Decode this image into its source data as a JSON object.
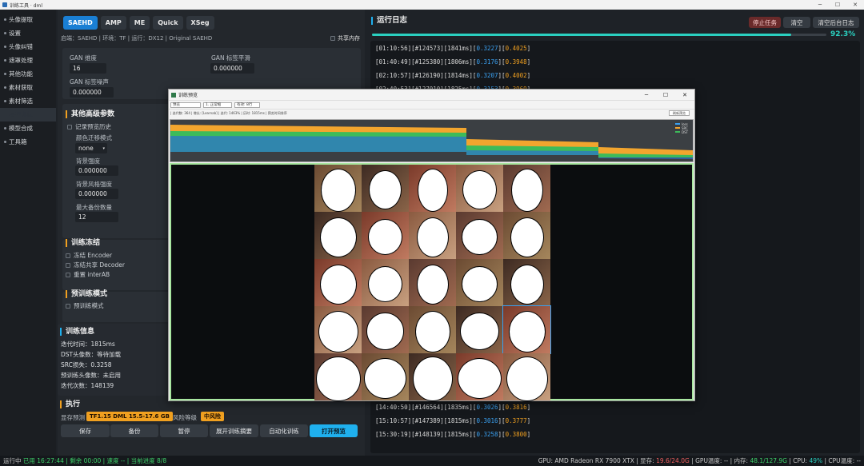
{
  "window": {
    "title": "训练工具 · dml"
  },
  "sidebar": {
    "items": [
      {
        "label": "头像提取",
        "dot": true,
        "active": false
      },
      {
        "label": "设置",
        "dot": true,
        "active": false
      },
      {
        "label": "头像纠错",
        "dot": true,
        "active": false
      },
      {
        "label": "遮罩处理",
        "dot": true,
        "active": false
      },
      {
        "label": "其他功能",
        "dot": true,
        "active": false
      },
      {
        "label": "素材获取",
        "dot": true,
        "active": false
      },
      {
        "label": "素材筛选",
        "dot": true,
        "active": false
      },
      {
        "label": "模型训练",
        "dot": false,
        "active": true
      },
      {
        "label": "模型合成",
        "dot": true,
        "active": false
      },
      {
        "label": "工具箱",
        "dot": true,
        "active": false
      }
    ]
  },
  "tabs": [
    {
      "label": "SAEHD",
      "active": true
    },
    {
      "label": "AMP"
    },
    {
      "label": "ME"
    },
    {
      "label": "Quick"
    },
    {
      "label": "XSeg"
    }
  ],
  "env": {
    "text": "启端：SAEHD | 环境：TF | 运行：DX12 | Original SAEHD",
    "share_label": "共享内存"
  },
  "gan": {
    "dims_label": "GAN 维度",
    "dims_value": "16",
    "smooth_label": "GAN 标签平滑",
    "smooth_value": "0.000000",
    "noise_label": "GAN 标签噪声",
    "noise_value": "0.000000"
  },
  "advanced": {
    "title": "其他高级参数",
    "record_history": "记录预览历史",
    "color_label": "颜色迁移模式",
    "color_value": "none",
    "bg_label": "背景强度",
    "bg_value": "0.000000",
    "bgstyle_label": "背景风格强度",
    "bgstyle_value": "0.000000",
    "backup_label": "最大备份数量",
    "backup_value": "12"
  },
  "freeze": {
    "title": "训练冻结",
    "items": [
      "冻结 Encoder",
      "冻结共享 Decoder",
      "重置 interAB"
    ]
  },
  "pretrain": {
    "title": "预训练模式",
    "item": "预训练模式"
  },
  "traininfo": {
    "title": "训练信息",
    "lines": [
      "迭代时间：1815ms",
      "DST头像数：等待加载",
      "SRC损失：0.3258",
      "预训练头像数：未启用",
      "迭代次数：148139"
    ]
  },
  "exec": {
    "title": "执行",
    "vram_label": "显存预测",
    "vram_value": "TF1.15 DML 15.5-17.6 GB",
    "risk_label": "风险等级",
    "risk_value": "中风险",
    "buttons": [
      "保存",
      "备份",
      "暂停",
      "展开训练摘要",
      "自动化训练",
      "打开预览"
    ]
  },
  "log": {
    "title": "运行日志",
    "stop": "停止任务",
    "clear": "清空",
    "clear_bg": "清空后台日志",
    "progress": 0.923,
    "progress_text": "92.3%",
    "top_lines": [
      {
        "t": "[01:10:56]",
        "it": "[#124573]",
        "ms": "[1841ms]",
        "a": "0.3227",
        "b": "0.4025"
      },
      {
        "t": "[01:40:49]",
        "it": "[#125380]",
        "ms": "[1806ms]",
        "a": "0.3176",
        "b": "0.3948"
      },
      {
        "t": "[02:10:57]",
        "it": "[#126190]",
        "ms": "[1814ms]",
        "a": "0.3207",
        "b": "0.4002"
      },
      {
        "t": "[02:40:53]",
        "it": "[#127010]",
        "ms": "[1825ms]",
        "a": "0.3153",
        "b": "0.3969"
      }
    ],
    "bottom_lines": [
      {
        "t": "[14:40:50]",
        "it": "[#146564]",
        "ms": "[1835ms]",
        "a": "0.3026",
        "b": "0.3816"
      },
      {
        "t": "[15:10:57]",
        "it": "[#147389]",
        "ms": "[1815ms]",
        "a": "0.3016",
        "b": "0.3777"
      },
      {
        "t": "[15:30:19]",
        "it": "[#148139]",
        "ms": "[1815ms]",
        "a": "0.3258",
        "b": "0.3800"
      }
    ]
  },
  "status": {
    "left_prefix": "运行中",
    "left_main": "已用 16:27:44 | 剩余 00:00 | 速度 -- | 当前进度 8/8",
    "gpu": "GPU: AMD Radeon RX 7900 XTX | 显存: ",
    "vram": "19.6/24.0G",
    "gpu_temp": " | GPU温度: -- | 内存: ",
    "mem": "48.1/127.9G",
    "cpu_pre": " | CPU: ",
    "cpu": "49%",
    "cpu_temp": " | CPU温度: --"
  },
  "preview": {
    "title": "训练预览",
    "sel1": "预览",
    "sel2": "1. 正常缩",
    "sel3": "有效: 8行",
    "stats": "| 迭代数: 364 | 增长: [Learnab] | 迭代: 1463% | 历时: 1815ms | 预览时间排序",
    "refresh": "刷新预览",
    "legend": [
      "loss",
      "SRC",
      "DST"
    ],
    "accent": "#a8e6a0"
  }
}
